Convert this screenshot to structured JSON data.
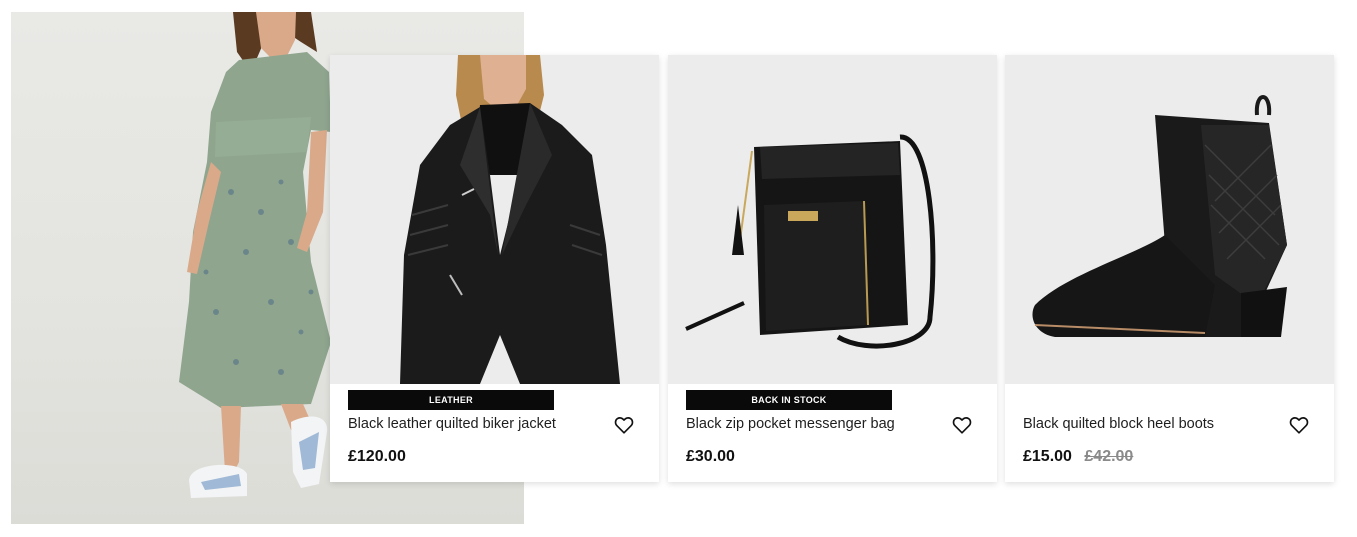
{
  "colors": {
    "badge_bg": "#0a0a0a",
    "badge_text": "#ffffff",
    "card_image_bg": "#efefef",
    "was_price": "#8a8a8a"
  },
  "products": [
    {
      "badge": "LEATHER",
      "title": "Black leather quilted biker jacket",
      "price": "£120.00",
      "was_price": "",
      "image": "black-leather-biker-jacket",
      "wishlist_icon": "heart-icon"
    },
    {
      "badge": "BACK IN STOCK",
      "title": "Black zip pocket messenger bag",
      "price": "£30.00",
      "was_price": "",
      "image": "black-messenger-bag",
      "wishlist_icon": "heart-icon"
    },
    {
      "badge": "",
      "title": "Black quilted block heel boots",
      "price": "£15.00",
      "was_price": "£42.00",
      "image": "black-quilted-ankle-boot",
      "wishlist_icon": "heart-icon"
    }
  ]
}
